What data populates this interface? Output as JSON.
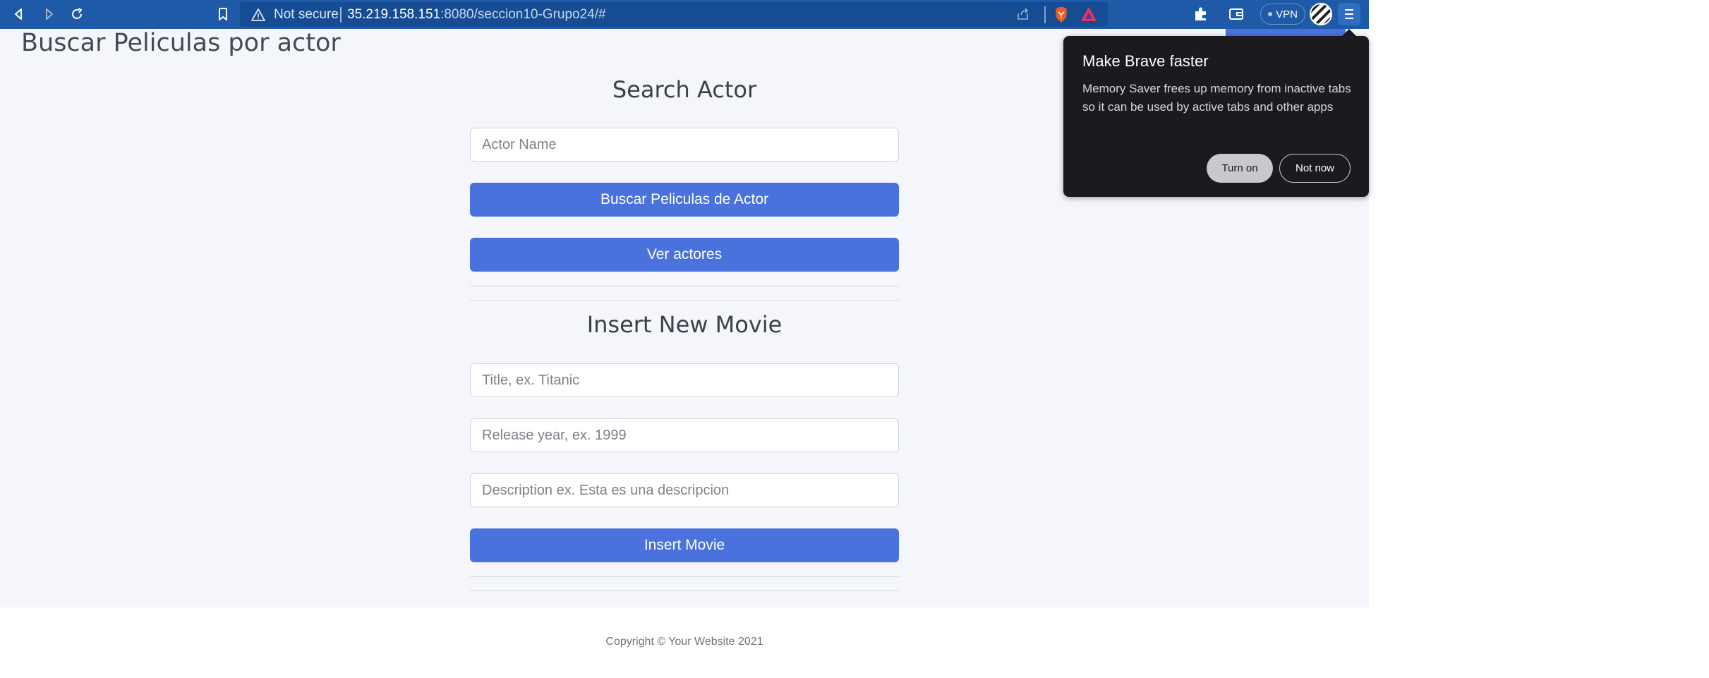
{
  "browser": {
    "security_label": "Not secure",
    "url_host": "35.219.158.151",
    "url_rest": ":8080/seccion10-Grupo24/#",
    "vpn_label": "VPN"
  },
  "page": {
    "title": "Buscar Peliculas por actor",
    "search": {
      "heading": "Search Actor",
      "actor_placeholder": "Actor Name",
      "search_button": "Buscar Peliculas de Actor",
      "view_button": "Ver actores"
    },
    "insert": {
      "heading": "Insert New Movie",
      "title_placeholder": "Title, ex. Titanic",
      "year_placeholder": "Release year, ex. 1999",
      "description_placeholder": "Description ex. Esta es una descripcion",
      "insert_button": "Insert Movie"
    },
    "footer": "Copyright © Your Website 2021"
  },
  "popup": {
    "title": "Make Brave faster",
    "body": "Memory Saver frees up memory from inactive tabs so it can be used by active tabs and other apps",
    "turn_on": "Turn on",
    "not_now": "Not now"
  }
}
